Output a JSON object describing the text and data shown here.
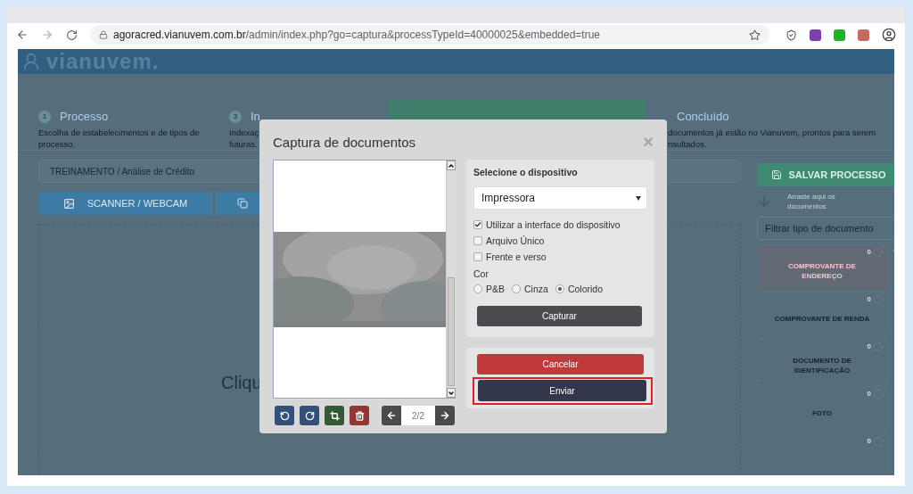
{
  "browser": {
    "url_host": "agoracred.vianuvem.com.br",
    "url_path": "/admin/index.php?go=captura&processTypeId=40000025&embedded=true"
  },
  "header": {
    "logo": "vianuvem."
  },
  "steps": [
    {
      "number": "1",
      "title": "Processo",
      "lines": [
        "Escolha de estabelecimentos e de tipos de",
        "processo."
      ],
      "selected": false
    },
    {
      "number": "3",
      "title": "In",
      "lines": [
        "Indexaç",
        "futuras."
      ],
      "selected": false
    },
    {
      "selected": true
    },
    {
      "title": "Concluído",
      "lines": [
        "documentos já estão no Vianuvem, prontos para serem",
        "nsultados."
      ],
      "selected": false
    }
  ],
  "process_field": {
    "value": "TREINAMENTO / Análise de Crédito"
  },
  "source_buttons": [
    "SCANNER / WEBCAM"
  ],
  "drop_zone": {
    "text": "Cliqu"
  },
  "sidebar": {
    "save_button": "SALVAR PROCESSO",
    "drag_hint": "Arraste aqui os documentos",
    "filter": {
      "placeholder": "Filtrar tipo de documento"
    },
    "documents": [
      {
        "name": "COMPROVANTE DE ENDEREÇO",
        "count": "0",
        "missing": true
      },
      {
        "name": "COMPROVANTE DE RENDA",
        "count": "0",
        "missing": false
      },
      {
        "name": "DOCUMENTO DE IDENTIFICAÇÃO",
        "count": "0",
        "missing": false
      },
      {
        "name": "FOTO",
        "count": "0",
        "missing": false
      },
      {
        "count": "0",
        "missing": false
      }
    ]
  },
  "modal": {
    "title": "Captura de documentos",
    "close": "×",
    "page_indicator": "2/2",
    "device_label": "Selecione o dispositivo",
    "device": "Impressora",
    "options": [
      {
        "label": "Utilizar a interface do dispositivo",
        "checked": true
      },
      {
        "label": "Arquivo Único",
        "checked": false
      },
      {
        "label": "Frente e verso",
        "checked": false
      }
    ],
    "color_label": "Cor",
    "color_modes": [
      {
        "label": "P&B",
        "selected": false
      },
      {
        "label": "Cinza",
        "selected": false
      },
      {
        "label": "Colorido",
        "selected": true
      }
    ],
    "capture_button": "Capturar",
    "cancel_button": "Cancelar",
    "send_button": {
      "label": "Enviar",
      "highlighted": true
    }
  }
}
